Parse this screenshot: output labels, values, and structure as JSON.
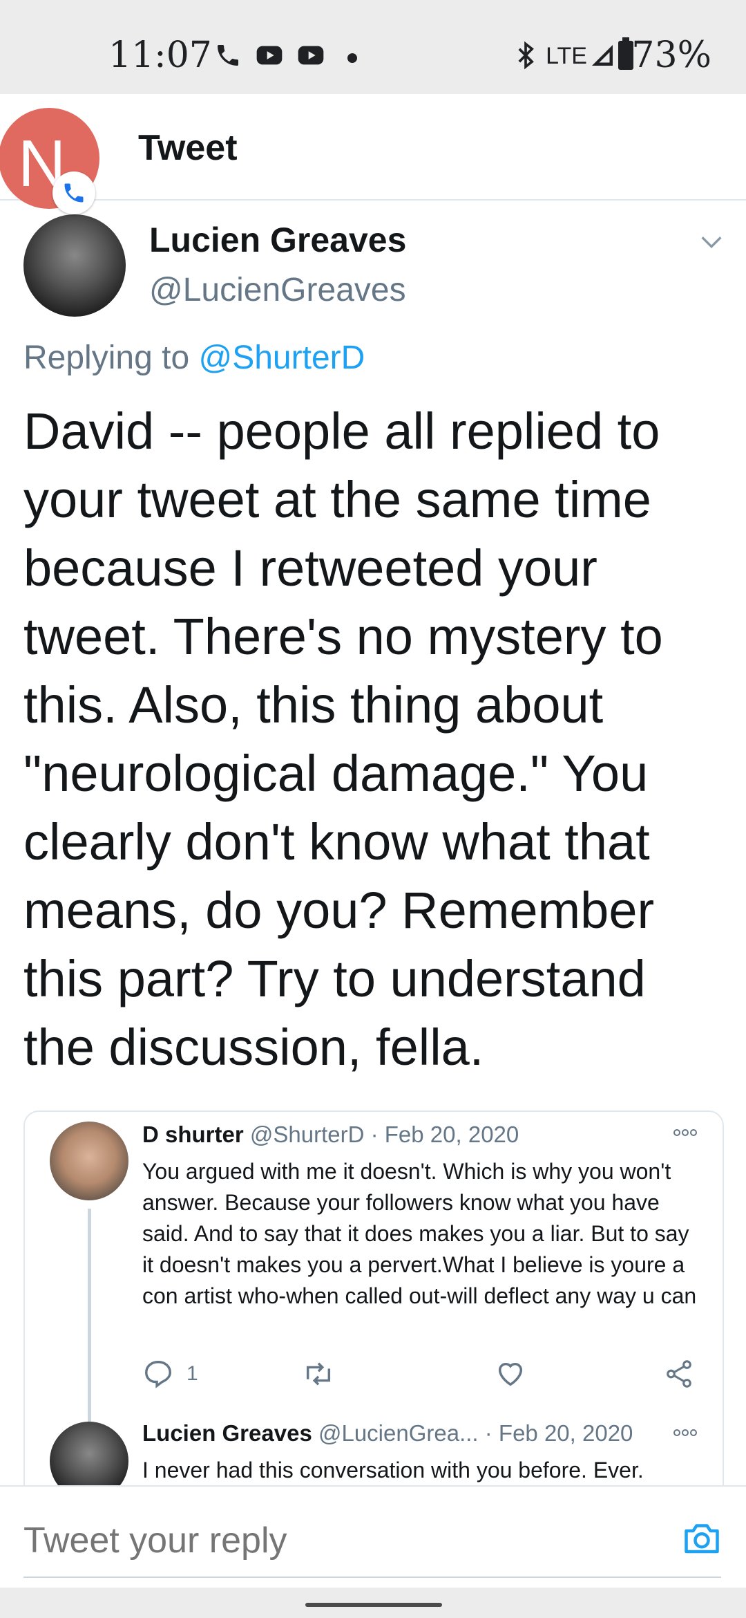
{
  "status_bar": {
    "time": "11:07",
    "network": "LTE",
    "battery": "73%",
    "icons": [
      "phone-icon",
      "youtube-icon",
      "youtube-icon",
      "dot-icon",
      "bluetooth-icon",
      "signal-icon",
      "battery-icon"
    ]
  },
  "header": {
    "title": "Tweet",
    "notification_letter": "N"
  },
  "tweet": {
    "author_name": "Lucien Greaves",
    "author_handle": "@LucienGreaves",
    "replying_prefix": "Replying to",
    "replying_to": "@ShurterD",
    "body": "David -- people all replied to your tweet at the same time because I retweeted your tweet. There's no mystery to this. Also, this thing about \"neurological damage.\" You clearly don't know what that means, do you? Remember this part? Try to understand the discussion, fella."
  },
  "quoted": {
    "first": {
      "name": "D shurter",
      "handle": "@ShurterD",
      "date": "· Feb 20, 2020",
      "text": "You argued with me it doesn't. Which is why you won't answer. Because your followers know what you have said. And to say that it does makes you a liar. But to say it doesn't makes you a pervert.What I believe is youre a con artist who-when called out-will deflect any way u can",
      "reply_count": "1"
    },
    "second": {
      "name": "Lucien Greaves",
      "handle": "@LucienGrea...",
      "date": "· Feb 20, 2020",
      "text": "I never had this conversation with you before. Ever."
    }
  },
  "reply_bar": {
    "placeholder": "Tweet your reply"
  },
  "colors": {
    "accent": "#1da1f2",
    "muted": "#657786",
    "notification": "#e06a60"
  }
}
